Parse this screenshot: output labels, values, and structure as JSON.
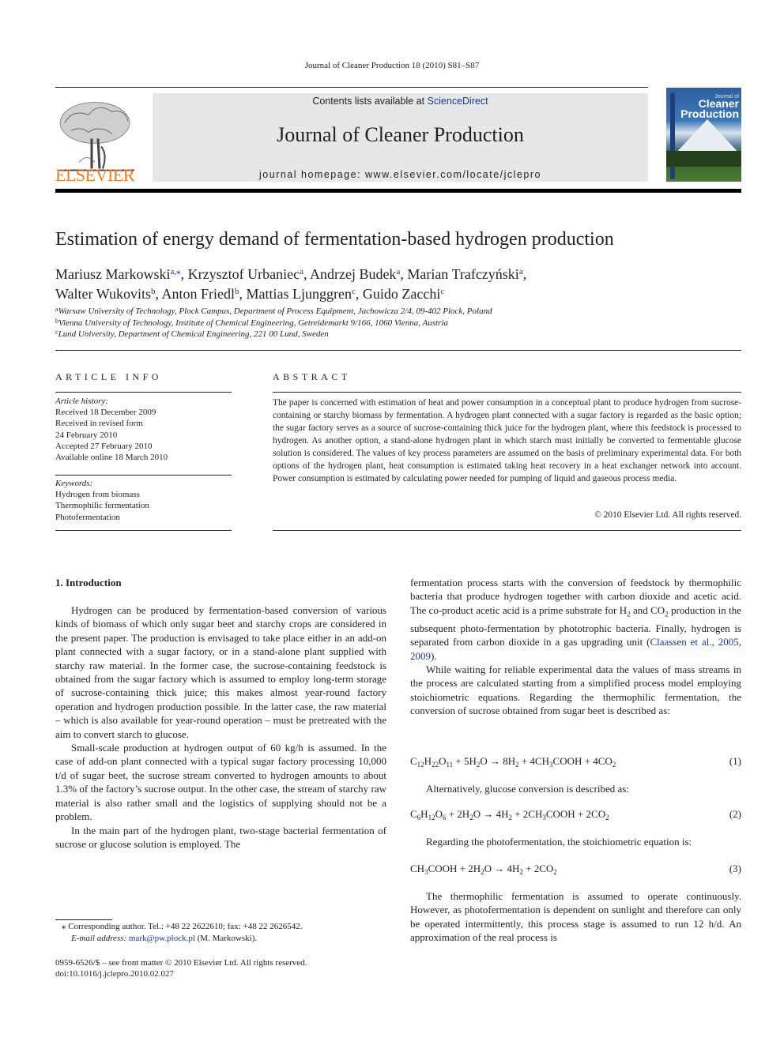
{
  "running_head": "Journal of Cleaner Production 18 (2010) S81–S87",
  "header": {
    "publisher_wordmark": "ELSEVIER",
    "logo_icon": "elsevier-tree-logo",
    "contents_prefix": "Contents lists available at ",
    "contents_link": "ScienceDirect",
    "journal_title": "Journal of Cleaner Production",
    "homepage": "journal homepage: www.elsevier.com/locate/jclepro",
    "cover": {
      "line1": "Journal of",
      "line2": "Cleaner",
      "line3": "Production"
    },
    "colors": {
      "elsevier_orange": "#f47b20",
      "link_blue": "#1a3a8c",
      "banner_gray": "#e6e7e8"
    }
  },
  "article": {
    "title": "Estimation of energy demand of fermentation-based hydrogen production",
    "authors": [
      {
        "name": "Mariusz Markowski",
        "aff": "a,⁎",
        "sep": ", "
      },
      {
        "name": "Krzysztof Urbaniec",
        "aff": "a",
        "sep": ", "
      },
      {
        "name": "Andrzej Budek",
        "aff": "a",
        "sep": ", "
      },
      {
        "name": "Marian Trafczyński",
        "aff": "a",
        "sep": ","
      },
      {
        "name": "Walter Wukovits",
        "aff": "b",
        "sep": ", "
      },
      {
        "name": "Anton Friedl",
        "aff": "b",
        "sep": ", "
      },
      {
        "name": "Mattias Ljunggren",
        "aff": "c",
        "sep": ", "
      },
      {
        "name": "Guido Zacchi",
        "aff": "c",
        "sep": ""
      }
    ],
    "affiliations": [
      {
        "key": "a",
        "text": "Warsaw University of Technology, Plock Campus, Department of Process Equipment, Jachowicza 2/4, 09-402 Plock, Poland"
      },
      {
        "key": "b",
        "text": "Vienna University of Technology, Institute of Chemical Engineering, Getreidemarkt 9/166, 1060 Vienna, Austria"
      },
      {
        "key": "c",
        "text": "Lund University, Department of Chemical Engineering, 221 00 Lund, Sweden"
      }
    ]
  },
  "article_info": {
    "heading": "ARTICLE INFO",
    "history_label": "Article history:",
    "history": [
      "Received 18 December 2009",
      "Received in revised form",
      "24 February 2010",
      "Accepted 27 February 2010",
      "Available online 18 March 2010"
    ],
    "keywords_label": "Keywords:",
    "keywords": [
      "Hydrogen from biomass",
      "Thermophilic fermentation",
      "Photofermentation"
    ]
  },
  "abstract": {
    "heading": "ABSTRACT",
    "text": "The paper is concerned with estimation of heat and power consumption in a conceptual plant to produce hydrogen from sucrose-containing or starchy biomass by fermentation. A hydrogen plant connected with a sugar factory is regarded as the basic option; the sugar factory serves as a source of sucrose-containing thick juice for the hydrogen plant, where this feedstock is processed to hydrogen. As another option, a stand-alone hydrogen plant in which starch must initially be converted to fermentable glucose solution is considered. The values of key process parameters are assumed on the basis of preliminary experimental data. For both options of the hydrogen plant, heat consumption is estimated taking heat recovery in a heat exchanger network into account. Power consumption is estimated by calculating power needed for pumping of liquid and gaseous process media.",
    "copyright": "© 2010 Elsevier Ltd. All rights reserved."
  },
  "body": {
    "section1_heading": "1.  Introduction",
    "left_paragraphs": [
      "Hydrogen can be produced by fermentation-based conversion of various kinds of biomass of which only sugar beet and starchy crops are considered in the present paper. The production is envisaged to take place either in an add-on plant connected with a sugar factory, or in a stand-alone plant supplied with starchy raw material. In the former case, the sucrose-containing feedstock is obtained from the sugar factory which is assumed to employ long-term storage of sucrose-containing thick juice; this makes almost year-round factory operation and hydrogen production possible. In the latter case, the raw material – which is also available for year-round operation – must be pretreated with the aim to convert starch to glucose.",
      "Small-scale production at hydrogen output of 60 kg/h is assumed. In the case of add-on plant connected with a typical sugar factory processing 10,000 t/d of sugar beet, the sucrose stream converted to hydrogen amounts to about 1.3% of the factory’s sucrose output. In the other case, the stream of starchy raw material is also rather small and the logistics of supplying should not be a problem.",
      "In the main part of the hydrogen plant, two-stage bacterial fermentation of sucrose or glucose solution is employed. The"
    ],
    "right_p1_before": "fermentation process starts with the conversion of feedstock by thermophilic bacteria that produce hydrogen together with carbon dioxide and acetic acid. The co-product acetic acid is a prime substrate for H",
    "right_p1_mid1": " and CO",
    "right_p1_mid2": " production in the subsequent photo-fermentation by phototrophic bacteria. Finally, hydrogen is separated from carbon dioxide in a gas upgrading unit (",
    "right_p1_citation": "Claassen et al., 2005, 2009",
    "right_p1_after": ").",
    "right_p2": "While waiting for reliable experimental data the values of mass streams in the process are calculated starting from a simplified process model employing stoichiometric equations. Regarding the thermophilic fermentation, the conversion of sucrose obtained from sugar beet is described as:",
    "equations": [
      {
        "html_label": "C12H22O11 + 5H2O → 8H2 + 4CH3COOH + 4CO2",
        "number": "(1)"
      },
      {
        "html_label": "C6H12O6 + 2H2O → 4H2 + 2CH3COOH + 2CO2",
        "number": "(2)"
      },
      {
        "html_label": "CH3COOH + 2H2O → 4H2 + 2CO2",
        "number": "(3)"
      }
    ],
    "between_eq1_eq2": "Alternatively, glucose conversion is described as:",
    "between_eq2_eq3": "Regarding the photofermentation, the stoichiometric equation is:",
    "right_p_last": "The thermophilic fermentation is assumed to operate continuously. However, as photofermentation is dependent on sunlight and therefore can only be operated intermittently, this process stage is assumed to run 12 h/d. An approximation of the real process is"
  },
  "footnotes": {
    "corresponding": "⁎  Corresponding author. Tel.: +48 22 2622610; fax: +48 22 2626542.",
    "email_label": "E-mail address: ",
    "email": "mark@pw.plock.pl",
    "email_suffix": " (M. Markowski).",
    "issn_line": "0959-6526/$ – see front matter © 2010 Elsevier Ltd. All rights reserved.",
    "doi": "doi:10.1016/j.jclepro.2010.02.027"
  }
}
